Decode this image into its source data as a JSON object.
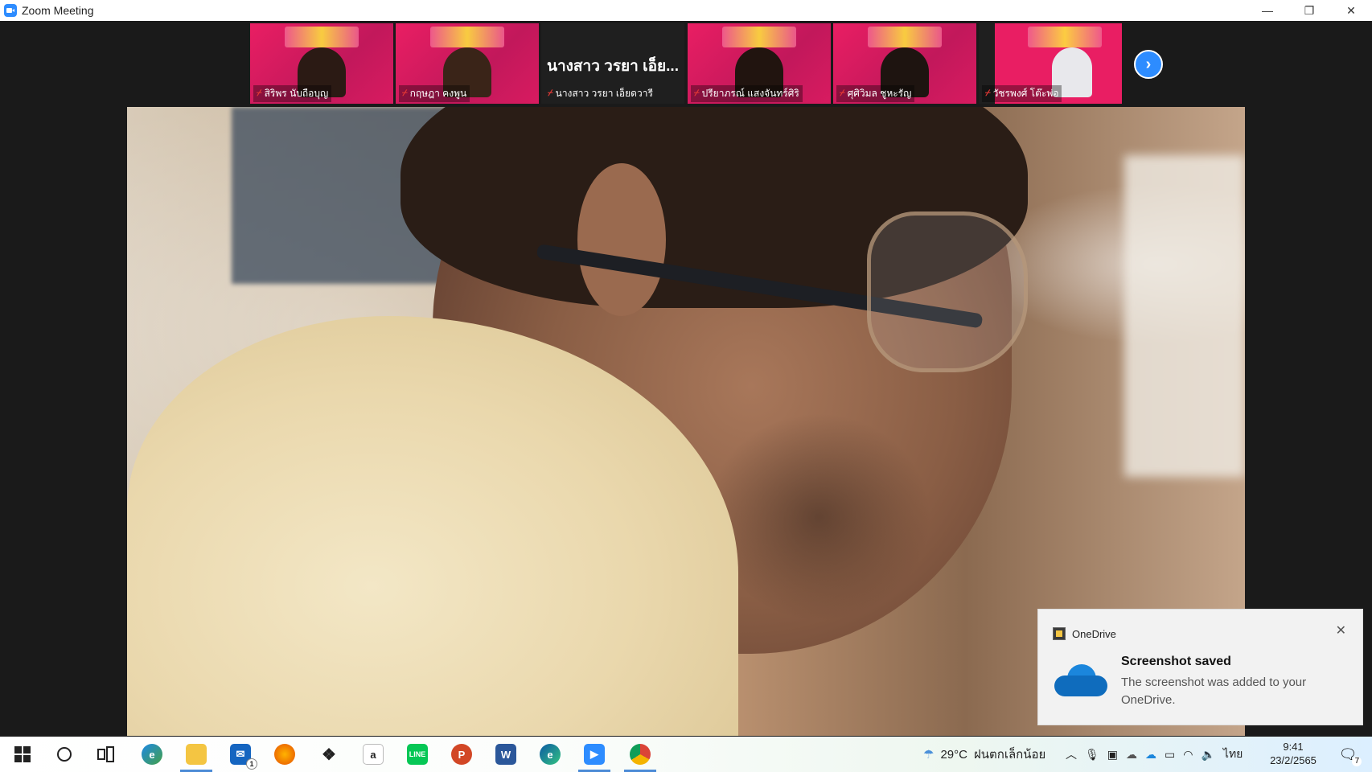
{
  "window": {
    "title": "Zoom Meeting",
    "minimize_icon": "—",
    "restore_icon": "❐",
    "close_icon": "✕"
  },
  "gallery": {
    "participants": [
      {
        "name": "สิริพร นับถือบุญ",
        "muted": true
      },
      {
        "name": "กฤษฎา คงพูน",
        "muted": true
      },
      {
        "name": "นางสาว วรยา เอ็ยดวารี",
        "display_big": "นางสาว วรยา เอ็ย...",
        "muted": true
      },
      {
        "name": "ปรียาภรณ์ แสงจันทร์ศิริ",
        "muted": true
      },
      {
        "name": "ศุศิวิมล ชูหะรัญ",
        "muted": true
      },
      {
        "name": "วัชรพงศ์ โต๊ะพ่อ",
        "muted": true
      }
    ],
    "next_icon": "›"
  },
  "toast": {
    "app": "OneDrive",
    "title": "Screenshot saved",
    "body": "The screenshot was added to your OneDrive.",
    "close_icon": "✕"
  },
  "taskbar": {
    "weather_temp": "29°C",
    "weather_text": "ฝนตกเล็กน้อย",
    "language": "ไทย",
    "time": "9:41",
    "date": "23/2/2565",
    "notification_count": "7",
    "mail_badge": "1"
  }
}
